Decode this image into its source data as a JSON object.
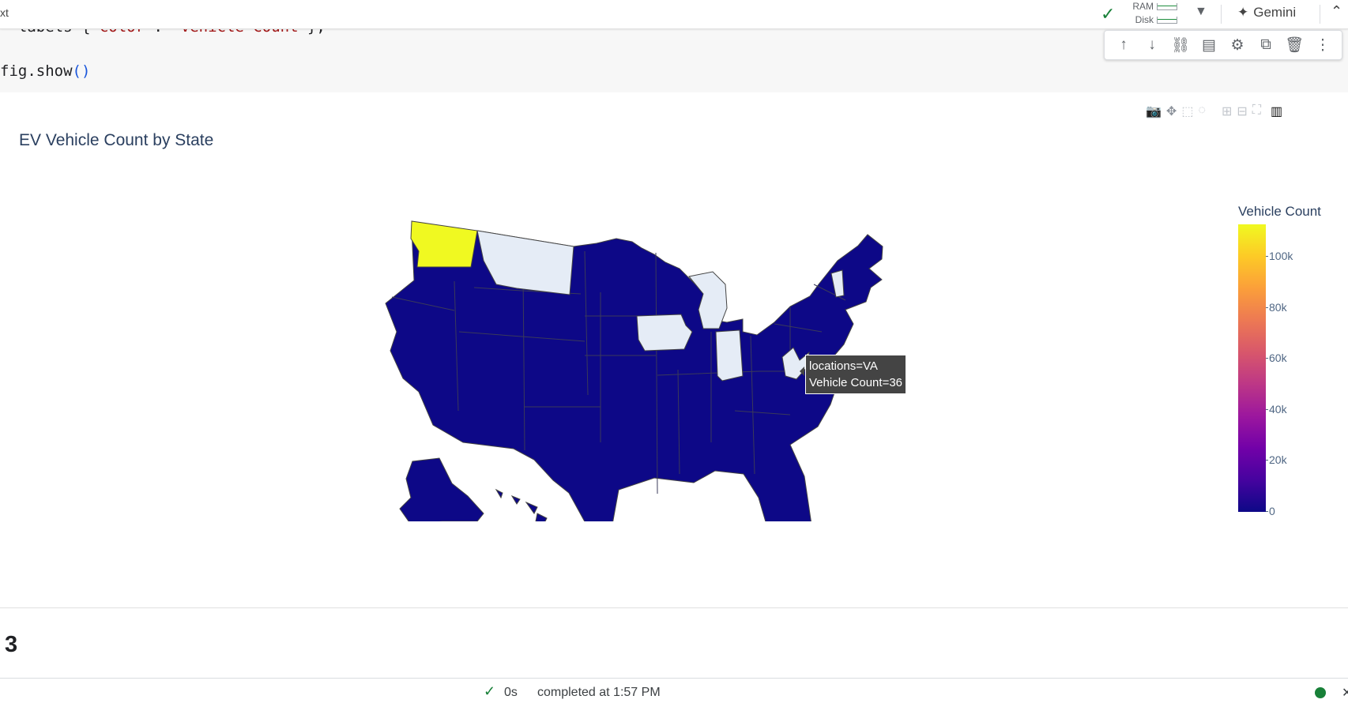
{
  "topbar": {
    "left_stub": "xt",
    "ram_label": "RAM",
    "disk_label": "Disk",
    "gemini_label": "Gemini"
  },
  "code": {
    "line1_prefix": "  labels={",
    "line1_key": "'color'",
    "line1_colon": ": ",
    "line1_value": "'Vehicle Count'",
    "line1_suffix": "},",
    "line2_prefix": "fig.show",
    "line2_parens": "()"
  },
  "icons": {
    "cell_toolbar": [
      "arrow-up-icon",
      "arrow-down-icon",
      "link-icon",
      "comment-icon",
      "gear-icon",
      "mirror-cell-icon",
      "trash-icon",
      "more-vert-icon"
    ],
    "modebar": [
      "camera-icon",
      "pan-icon",
      "box-select-icon",
      "lasso-icon",
      "zoom-in-icon",
      "zoom-out-icon",
      "reset-axes-icon",
      "plotly-logo-icon"
    ]
  },
  "colors": {
    "colorscale": [
      "#0d0887",
      "#46039f",
      "#7201a8",
      "#9c179e",
      "#bd3786",
      "#d8576b",
      "#ed7953",
      "#fb9f3a",
      "#fdca26",
      "#f0f921"
    ],
    "no_data_fill": "#e5ecf6",
    "state_border": "#444444"
  },
  "chart_data": {
    "type": "choropleth",
    "title": "EV Vehicle Count by State",
    "colorbar_title": "Vehicle Count",
    "colorbar_ticks": [
      "100k",
      "80k",
      "60k",
      "40k",
      "20k",
      "0"
    ],
    "color_range": [
      0,
      112000
    ],
    "highlight_state": {
      "location": "WA",
      "approx_value": 112000
    },
    "no_data_states": [
      "MT",
      "IA",
      "IN",
      "WV",
      "VT"
    ],
    "hover": {
      "line1": "locations=VA",
      "line2": "Vehicle Count=36",
      "location": "VA",
      "value": 36
    }
  },
  "footer": {
    "next_heading": "3",
    "duration": "0s",
    "message": "completed at 1:57 PM"
  }
}
